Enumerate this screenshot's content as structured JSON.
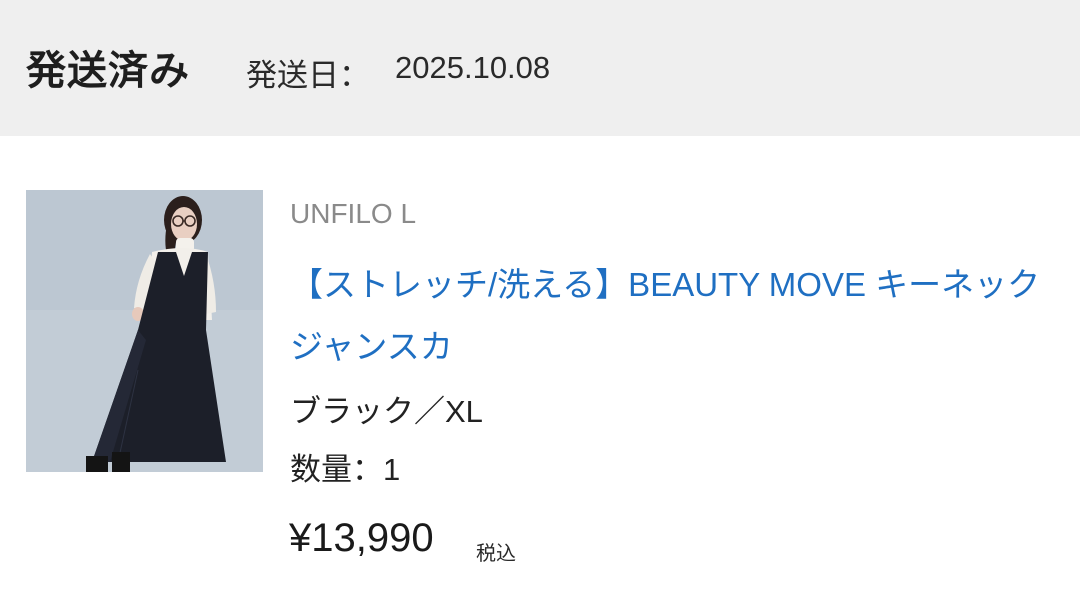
{
  "header": {
    "status": "発送済み",
    "ship_date_label": "発送日：",
    "ship_date": "2025.10.08"
  },
  "product": {
    "brand": "UNFILO L",
    "name": "【ストレッチ/洗える】BEAUTY MOVE キーネックジャンスカ",
    "variant": "ブラック／XL",
    "quantity": "数量：1",
    "price": "¥13,990",
    "tax_note": "税込",
    "link_color": "#1f6fc2"
  }
}
